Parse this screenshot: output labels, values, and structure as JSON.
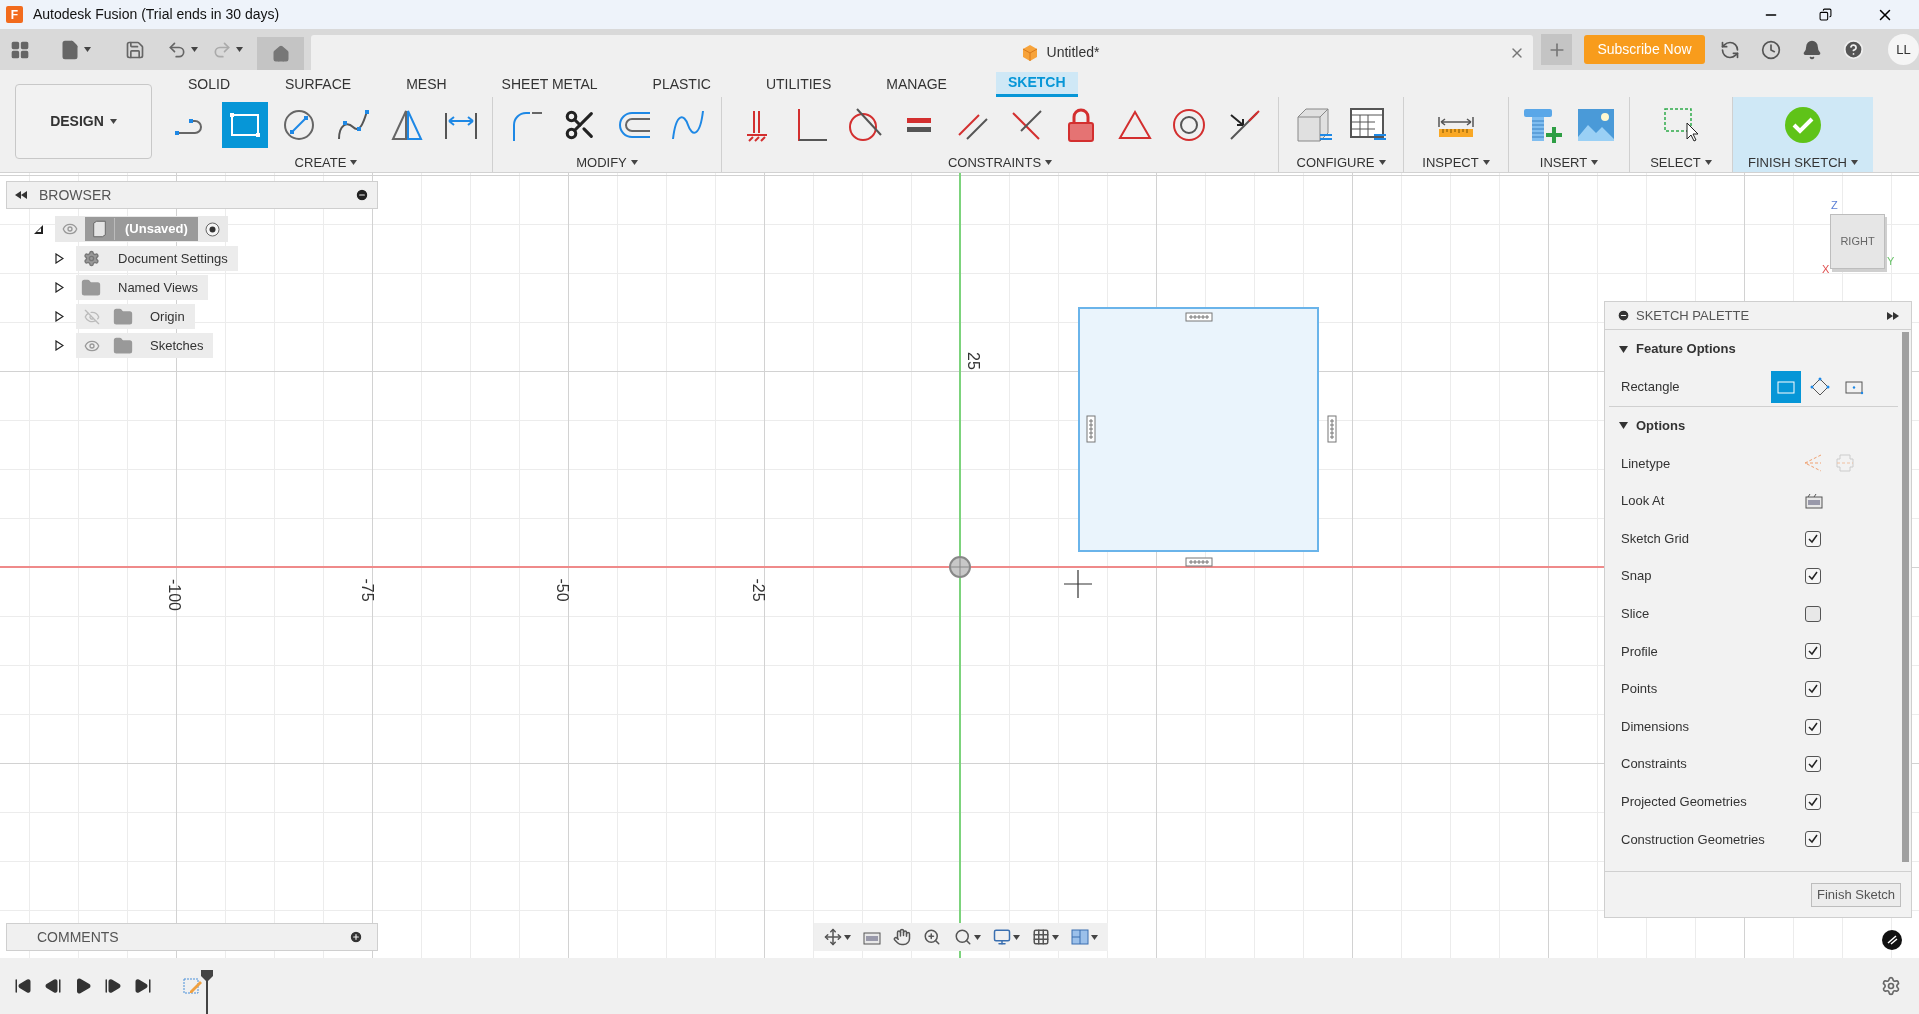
{
  "window": {
    "title": "Autodesk Fusion (Trial ends in 30 days)",
    "logo_letter": "F"
  },
  "document_tab": {
    "title": "Untitled*"
  },
  "subscribe_button": "Subscribe Now",
  "user_initials": "LL",
  "workspace": "DESIGN",
  "ribbon_tabs": [
    {
      "label": "SOLID",
      "selected": false
    },
    {
      "label": "SURFACE",
      "selected": false
    },
    {
      "label": "MESH",
      "selected": false
    },
    {
      "label": "SHEET METAL",
      "selected": false
    },
    {
      "label": "PLASTIC",
      "selected": false
    },
    {
      "label": "UTILITIES",
      "selected": false
    },
    {
      "label": "MANAGE",
      "selected": false
    },
    {
      "label": "SKETCH",
      "selected": true
    }
  ],
  "ribbon_groups": [
    {
      "label": "CREATE",
      "highlight": false,
      "tools": [
        {
          "kind": "line",
          "selected": false
        },
        {
          "kind": "rectangle",
          "selected": true
        },
        {
          "kind": "circle",
          "selected": false
        },
        {
          "kind": "spline",
          "selected": false
        },
        {
          "kind": "mirror",
          "selected": false
        },
        {
          "kind": "dimension",
          "selected": false
        }
      ]
    },
    {
      "label": "MODIFY",
      "highlight": false,
      "tools": [
        {
          "kind": "fillet",
          "selected": false
        },
        {
          "kind": "trim",
          "selected": false
        },
        {
          "kind": "offset",
          "selected": false
        },
        {
          "kind": "curve",
          "selected": false
        }
      ]
    },
    {
      "label": "CONSTRAINTS",
      "highlight": false,
      "tools": [
        {
          "kind": "fix",
          "selected": false
        },
        {
          "kind": "perpendicular",
          "selected": false
        },
        {
          "kind": "tangent",
          "selected": false
        },
        {
          "kind": "equal",
          "selected": false
        },
        {
          "kind": "parallel",
          "selected": false
        },
        {
          "kind": "cross",
          "selected": false
        },
        {
          "kind": "lock",
          "selected": false
        },
        {
          "kind": "triangle",
          "selected": false
        },
        {
          "kind": "concentric",
          "selected": false
        },
        {
          "kind": "midpoint",
          "selected": false
        }
      ]
    },
    {
      "label": "CONFIGURE",
      "highlight": false,
      "tools": [
        {
          "kind": "cube",
          "selected": false
        },
        {
          "kind": "table",
          "selected": false
        }
      ]
    },
    {
      "label": "INSPECT",
      "highlight": false,
      "tools": [
        {
          "kind": "ruler",
          "selected": false
        }
      ]
    },
    {
      "label": "INSERT",
      "highlight": false,
      "tools": [
        {
          "kind": "bolt",
          "selected": false
        },
        {
          "kind": "image",
          "selected": false
        }
      ]
    },
    {
      "label": "SELECT",
      "highlight": false,
      "tools": [
        {
          "kind": "select",
          "selected": false
        }
      ]
    },
    {
      "label": "FINISH SKETCH",
      "highlight": true,
      "tools": [
        {
          "kind": "finish",
          "selected": false
        }
      ]
    }
  ],
  "browser": {
    "title": "BROWSER",
    "root": {
      "label": "(Unsaved)",
      "expanded": true,
      "visible": true,
      "active": true,
      "children": [
        {
          "label": "Document Settings",
          "kind": "settings",
          "expanded": false
        },
        {
          "label": "Named Views",
          "kind": "folder",
          "expanded": false
        },
        {
          "label": "Origin",
          "kind": "folder",
          "expanded": false,
          "visible": false
        },
        {
          "label": "Sketches",
          "kind": "folder",
          "expanded": false,
          "visible": true
        }
      ]
    }
  },
  "axis_labels": [
    {
      "text": "-100"
    },
    {
      "text": "-75"
    },
    {
      "text": "-50"
    },
    {
      "text": "-25"
    },
    {
      "text": "25"
    }
  ],
  "view_cube": {
    "face": "RIGHT",
    "axes": [
      "Z",
      "Y",
      "X"
    ]
  },
  "sketch_palette": {
    "title": "SKETCH PALETTE",
    "sections": [
      {
        "title": "Feature Options",
        "expanded": true,
        "rows": [
          {
            "kind": "mode",
            "label": "Rectangle",
            "options": [
              {
                "kind": "two_point",
                "selected": true
              },
              {
                "kind": "three_point",
                "selected": false
              },
              {
                "kind": "center",
                "selected": false
              }
            ]
          }
        ]
      },
      {
        "title": "Options",
        "expanded": true,
        "rows": [
          {
            "kind": "linetype",
            "label": "Linetype"
          },
          {
            "kind": "look_at",
            "label": "Look At"
          },
          {
            "kind": "checkbox",
            "label": "Sketch Grid",
            "checked": true
          },
          {
            "kind": "checkbox",
            "label": "Snap",
            "checked": true
          },
          {
            "kind": "checkbox",
            "label": "Slice",
            "checked": false
          },
          {
            "kind": "checkbox",
            "label": "Profile",
            "checked": true
          },
          {
            "kind": "checkbox",
            "label": "Points",
            "checked": true
          },
          {
            "kind": "checkbox",
            "label": "Dimensions",
            "checked": true
          },
          {
            "kind": "checkbox",
            "label": "Constraints",
            "checked": true
          },
          {
            "kind": "checkbox",
            "label": "Projected Geometries",
            "checked": true
          },
          {
            "kind": "checkbox",
            "label": "Construction Geometries",
            "checked": true
          }
        ]
      }
    ],
    "finish_button": "Finish Sketch"
  },
  "comments": {
    "title": "COMMENTS"
  }
}
